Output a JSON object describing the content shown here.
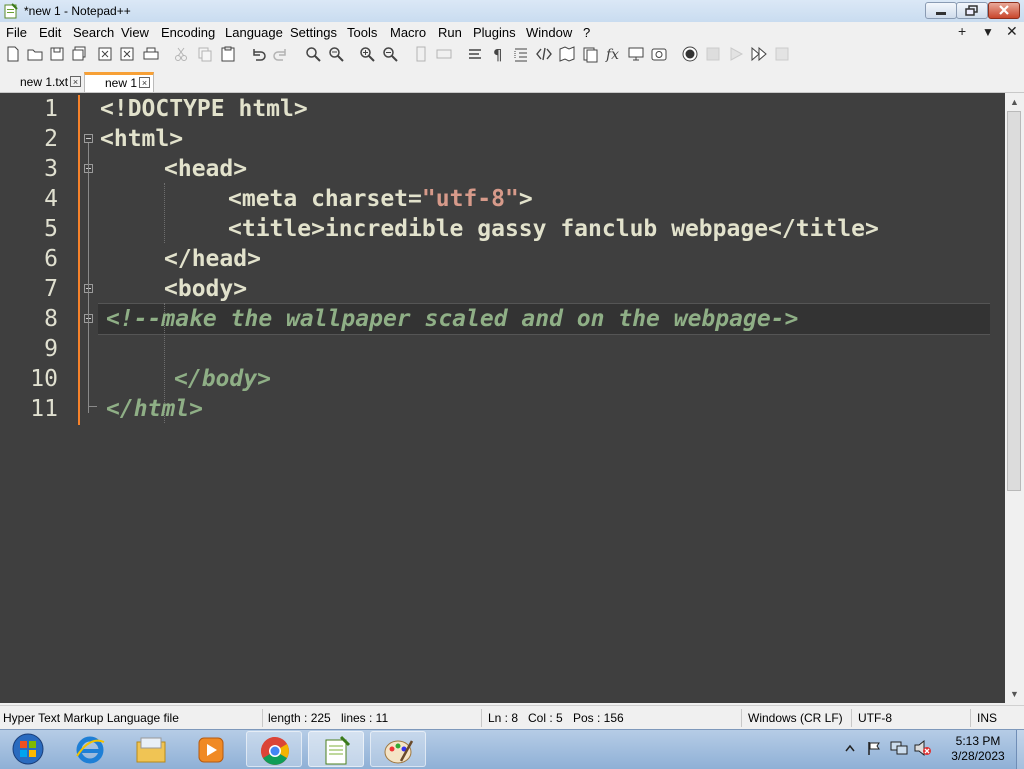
{
  "window": {
    "title": "*new 1 - Notepad++"
  },
  "menu": {
    "items": [
      "File",
      "Edit",
      "Search",
      "View",
      "Encoding",
      "Language",
      "Settings",
      "Tools",
      "Macro",
      "Run",
      "Plugins",
      "Window",
      "?"
    ],
    "right_controls": [
      "+",
      "▼",
      "✕"
    ]
  },
  "toolbar": {
    "icons": [
      "new-file-icon",
      "open-file-icon",
      "save-icon",
      "save-all-icon",
      "close-icon",
      "close-all-icon",
      "print-icon",
      "cut-icon",
      "copy-icon",
      "paste-icon",
      "undo-icon",
      "redo-icon",
      "find-icon",
      "replace-icon",
      "zoom-in-icon",
      "zoom-out-icon",
      "sync-vertical-icon",
      "sync-horizontal-icon",
      "word-wrap-icon",
      "show-all-chars-icon",
      "indent-guide-icon",
      "xml-tag-icon",
      "document-map-icon",
      "function-list-icon",
      "function-icon",
      "monitor-icon",
      "folder-workspace-icon",
      "record-macro-icon",
      "stop-record-icon",
      "play-macro-icon",
      "run-macro-multiple-icon",
      "save-macro-icon"
    ]
  },
  "tabs": [
    {
      "label": "new 1.txt",
      "active": false
    },
    {
      "label": "new 1",
      "active": true
    }
  ],
  "editor": {
    "line_numbers": [
      "1",
      "2",
      "3",
      "4",
      "5",
      "6",
      "7",
      "8",
      "9",
      "10",
      "11"
    ],
    "lines": {
      "l1": "<!DOCTYPE html>",
      "l2": "<html>",
      "l3": "<head>",
      "l4a": "<meta charset=",
      "l4b": "\"utf-8\"",
      "l4c": ">",
      "l5": "<title>incredible gassy fanclub webpage</title>",
      "l6": "</head>",
      "l7": "<body>",
      "l8": "<!--make the wallpaper scaled and on the webpage->",
      "l9": "",
      "l10": "</body>",
      "l11": "</html>"
    }
  },
  "status": {
    "file_type": "Hyper Text Markup Language file",
    "length": "length : 225",
    "lines": "lines : 11",
    "ln": "Ln : 8",
    "col": "Col : 5",
    "pos": "Pos : 156",
    "eol": "Windows (CR LF)",
    "encoding": "UTF-8",
    "mode": "INS"
  },
  "taskbar": {
    "apps": [
      "start-orb",
      "internet-explorer",
      "file-explorer",
      "media-player",
      "chrome",
      "notepad-plus-plus",
      "paint"
    ],
    "time": "5:13 PM",
    "date": "3/28/2023"
  },
  "colors": {
    "editor_bg": "#3f3f3f",
    "change_bar": "#f7822a",
    "tab_accent": "#f7a036"
  }
}
